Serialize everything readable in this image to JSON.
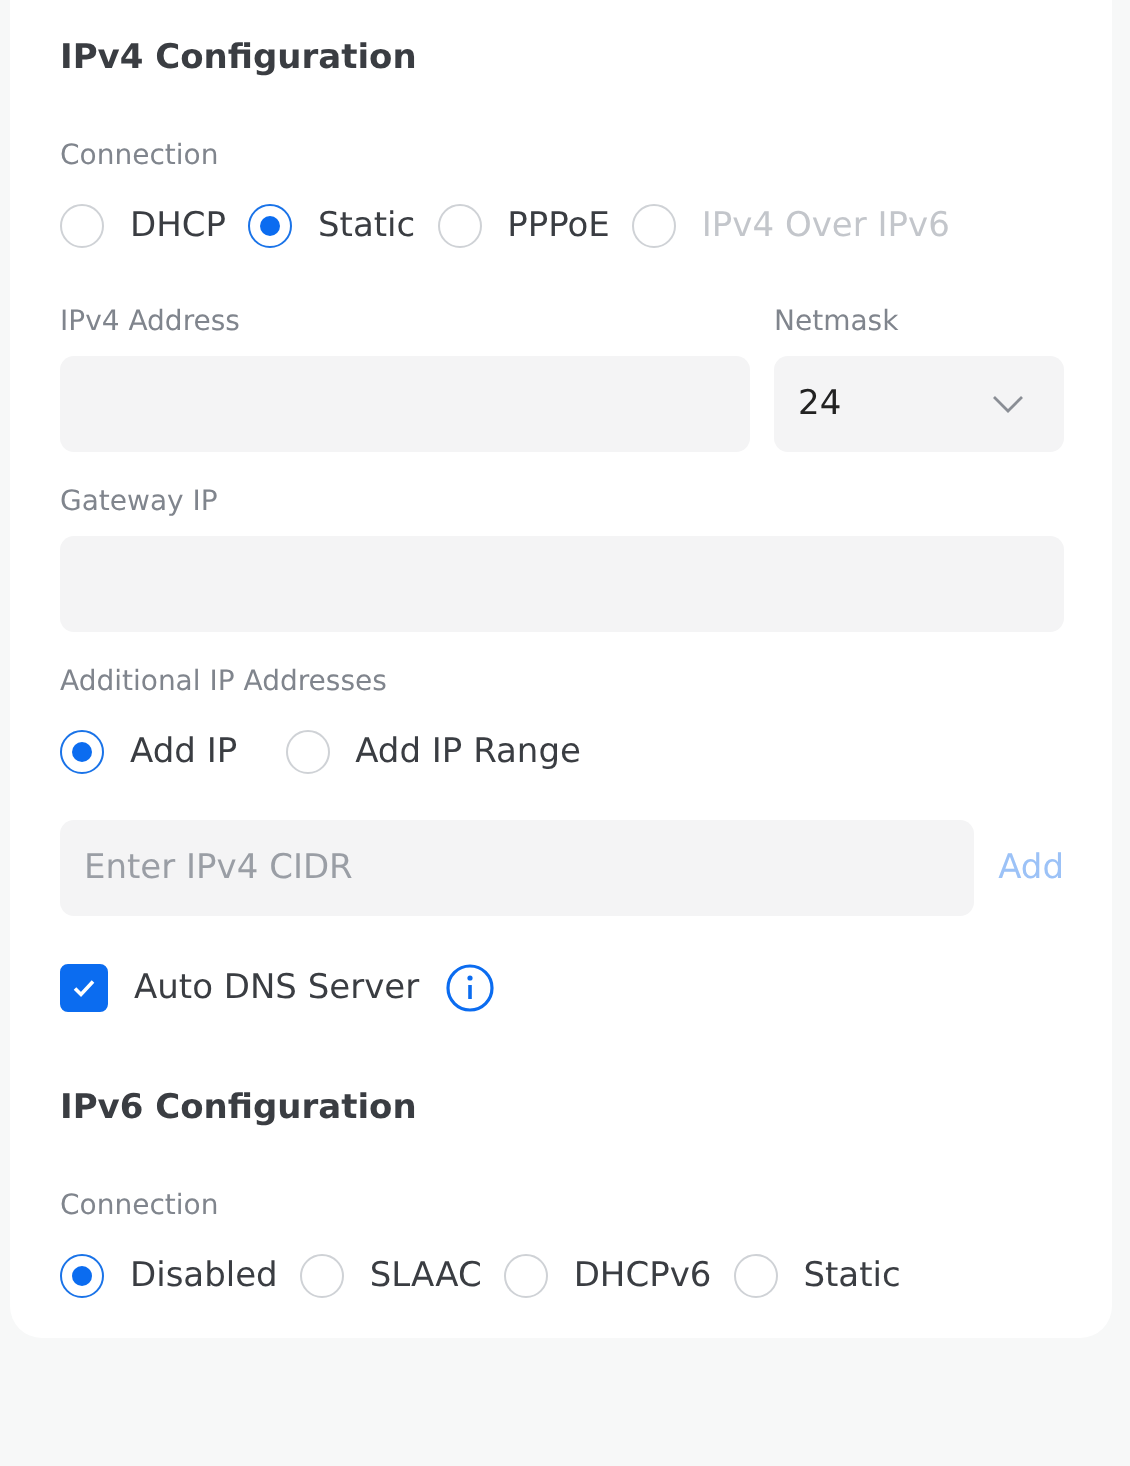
{
  "ipv4": {
    "title": "IPv4 Configuration",
    "connection": {
      "label": "Connection",
      "options": [
        {
          "label": "DHCP",
          "selected": false,
          "disabled": false
        },
        {
          "label": "Static",
          "selected": true,
          "disabled": false
        },
        {
          "label": "PPPoE",
          "selected": false,
          "disabled": false
        },
        {
          "label": "IPv4 Over IPv6",
          "selected": false,
          "disabled": true
        }
      ]
    },
    "address": {
      "label": "IPv4 Address"
    },
    "netmask": {
      "label": "Netmask",
      "value": "24"
    },
    "gateway": {
      "label": "Gateway IP"
    },
    "additional": {
      "label": "Additional IP Addresses",
      "options": [
        {
          "label": "Add IP",
          "selected": true,
          "disabled": false
        },
        {
          "label": "Add IP Range",
          "selected": false,
          "disabled": false
        }
      ],
      "input": {
        "placeholder": "Enter IPv4 CIDR"
      },
      "add_button": {
        "label": "Add",
        "disabled": true
      }
    },
    "auto_dns": {
      "label": "Auto DNS Server",
      "checked": true
    }
  },
  "ipv6": {
    "title": "IPv6 Configuration",
    "connection": {
      "label": "Connection",
      "options": [
        {
          "label": "Disabled",
          "selected": true,
          "disabled": false
        },
        {
          "label": "SLAAC",
          "selected": false,
          "disabled": false
        },
        {
          "label": "DHCPv6",
          "selected": false,
          "disabled": false
        },
        {
          "label": "Static",
          "selected": false,
          "disabled": false
        }
      ]
    }
  }
}
